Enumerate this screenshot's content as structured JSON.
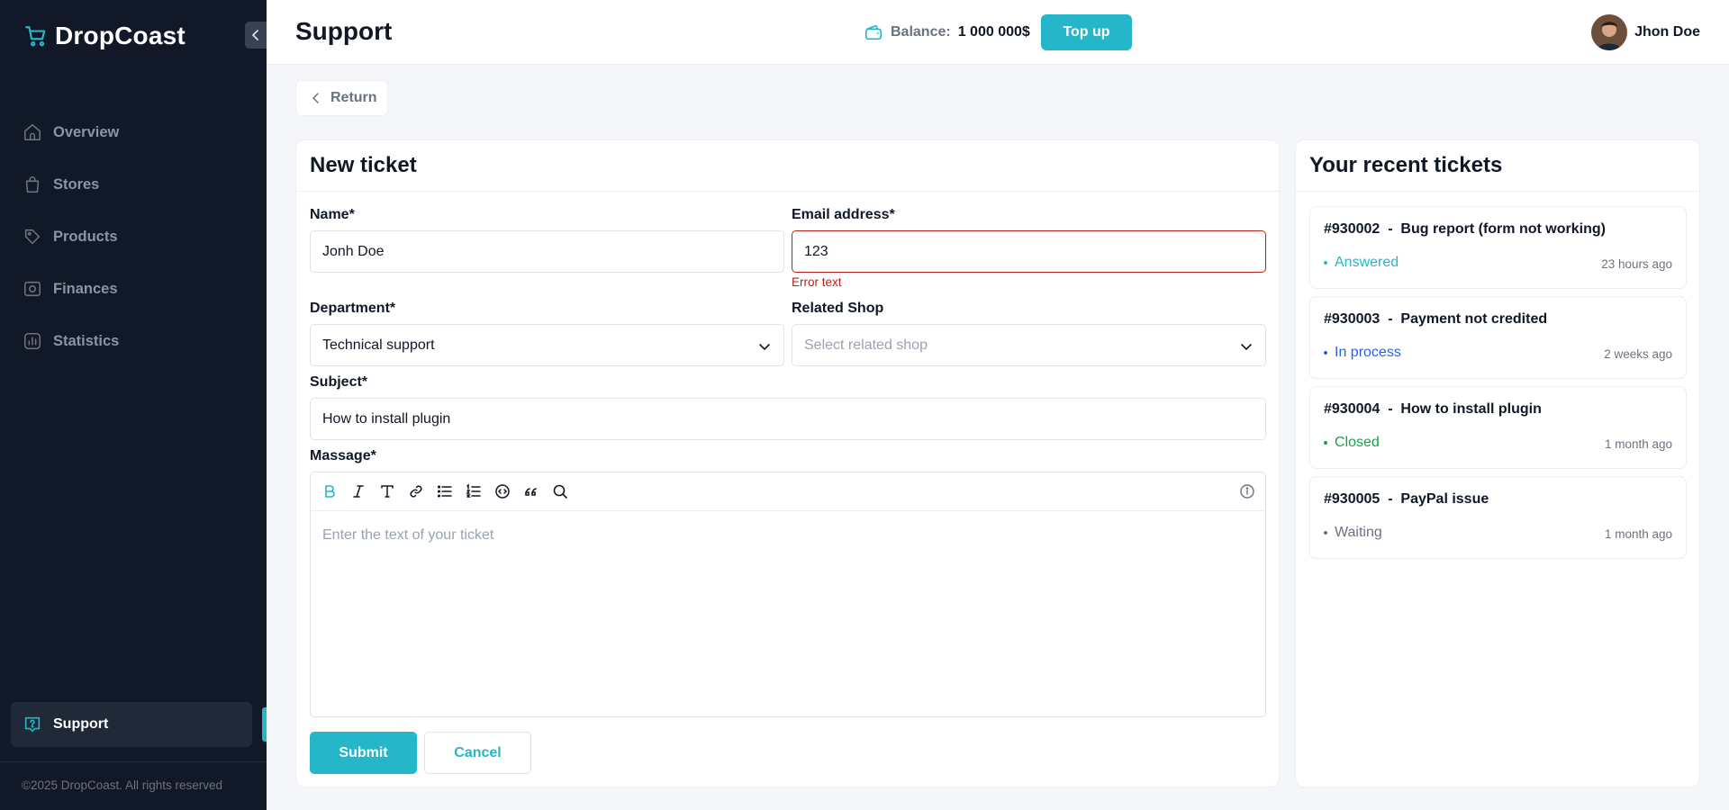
{
  "app": {
    "name": "DropCoast"
  },
  "sidebar": {
    "items": [
      {
        "label": "Overview",
        "icon": "home-icon"
      },
      {
        "label": "Stores",
        "icon": "bag-icon"
      },
      {
        "label": "Products",
        "icon": "tag-icon"
      },
      {
        "label": "Finances",
        "icon": "finance-icon"
      },
      {
        "label": "Statistics",
        "icon": "chart-icon"
      }
    ],
    "support": {
      "label": "Support",
      "icon": "support-icon"
    },
    "copyright": "©2025 DropCoast. All rights reserved"
  },
  "header": {
    "title": "Support",
    "balance_label": "Balance:",
    "balance_value": "1 000 000$",
    "topup_label": "Top up",
    "user_name": "Jhon Doe"
  },
  "return_label": "Return",
  "form": {
    "title": "New ticket",
    "name": {
      "label": "Name*",
      "value": "Jonh Doe"
    },
    "email": {
      "label": "Email address*",
      "value": "123",
      "error": "Error text"
    },
    "department": {
      "label": "Department*",
      "value": "Technical support"
    },
    "shop": {
      "label": "Related Shop",
      "placeholder": "Select related shop"
    },
    "subject": {
      "label": "Subject*",
      "value": "How to install plugin"
    },
    "message": {
      "label": "Massage*",
      "placeholder": "Enter the text of your ticket"
    },
    "submit_label": "Submit",
    "cancel_label": "Cancel"
  },
  "recent": {
    "title": "Your recent tickets",
    "tickets": [
      {
        "id": "#930002",
        "sep": "-",
        "subject": "Bug report (form not working)",
        "status": "Answered",
        "time": "23 hours ago"
      },
      {
        "id": "#930003",
        "sep": "-",
        "subject": "Payment not credited",
        "status": "In process",
        "time": "2 weeks ago"
      },
      {
        "id": "#930004",
        "sep": "-",
        "subject": "How to install plugin",
        "status": "Closed",
        "time": "1 month ago"
      },
      {
        "id": "#930005",
        "sep": "-",
        "subject": "PayPal issue",
        "status": "Waiting",
        "time": "1 month ago"
      }
    ]
  },
  "colors": {
    "accent": "#26b6c9",
    "sidebar_bg": "#111827",
    "error": "#b42318",
    "status_answered": "#26b6c9",
    "status_in_process": "#2563eb",
    "status_closed": "#16a34a",
    "status_waiting": "#6b7280"
  }
}
